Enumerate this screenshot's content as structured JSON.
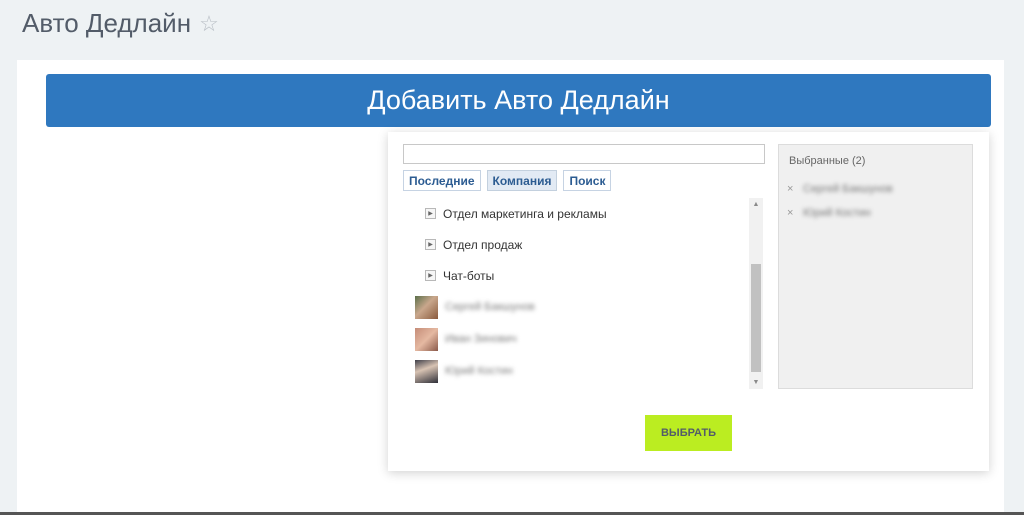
{
  "header": {
    "title": "Авто Дедлайн",
    "star_icon": "☆"
  },
  "main": {
    "add_button_label": "Добавить Авто Дедлайн"
  },
  "popup": {
    "search": {
      "value": "",
      "placeholder": ""
    },
    "tabs": [
      {
        "label": "Последние",
        "active": false
      },
      {
        "label": "Компания",
        "active": true
      },
      {
        "label": "Поиск",
        "active": false
      }
    ],
    "departments": [
      {
        "label": "Отдел маркетинга и рекламы"
      },
      {
        "label": "Отдел продаж"
      },
      {
        "label": "Чат-боты"
      }
    ],
    "users": [
      {
        "name": "Сергей Бакшунов",
        "avatar_icon": "user-photo"
      },
      {
        "name": "Иван Зинович",
        "avatar_icon": "user-photo"
      },
      {
        "name": "Юрий Костин",
        "avatar_icon": "user-photo"
      }
    ],
    "selected": {
      "title": "Выбранные (2)",
      "items": [
        {
          "name": "Сергей Бакшунов"
        },
        {
          "name": "Юрий Костин"
        }
      ]
    },
    "choose_button_label": "ВЫБРАТЬ"
  },
  "icons": {
    "remove": "×",
    "expand": "▶",
    "scroll_up": "▲",
    "scroll_down": "▼"
  },
  "colors": {
    "accent": "#2f78bf",
    "choose_button": "#bbed21",
    "background": "#eef2f4"
  }
}
